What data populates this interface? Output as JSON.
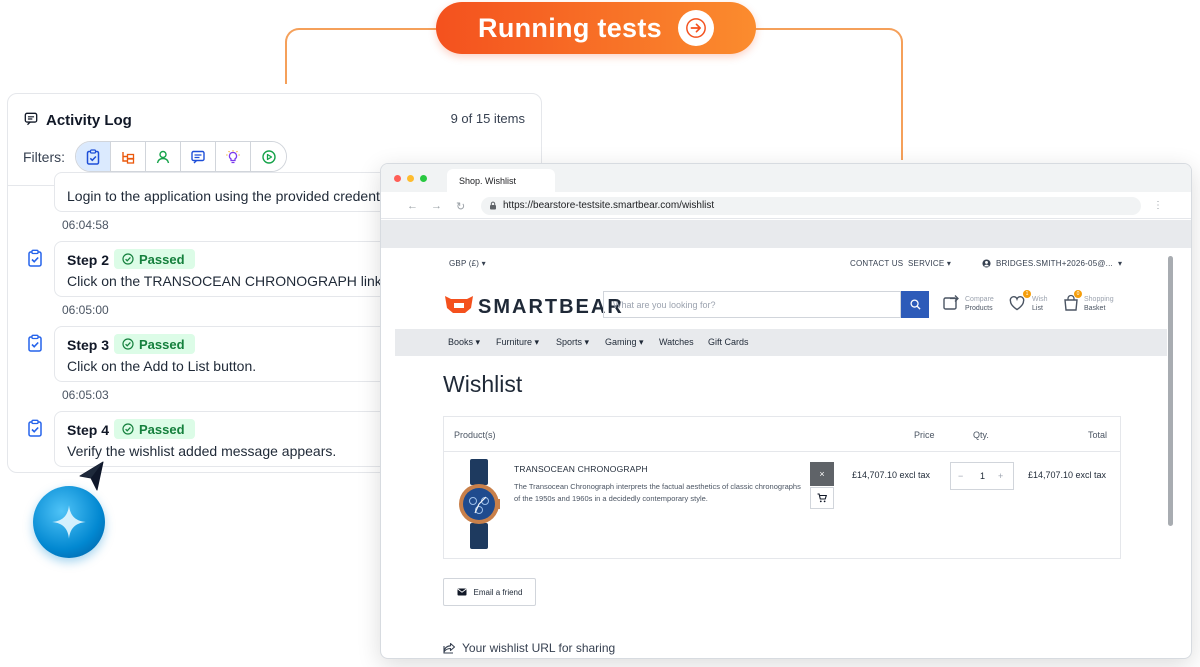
{
  "banner": {
    "label": "Running tests"
  },
  "activity_log": {
    "title": "Activity Log",
    "count": "9 of 15 items",
    "filters_label": "Filters:",
    "filters": [
      "steps-icon",
      "tree-icon",
      "user-icon",
      "comment-icon",
      "lightbulb-icon",
      "play-icon"
    ],
    "entries": [
      {
        "description": "Login to the application using the provided credentials.",
        "time": "06:04:58"
      },
      {
        "step": "Step 2",
        "status": "Passed",
        "description": "Click on the TRANSOCEAN CHRONOGRAPH link.",
        "time": "06:05:00"
      },
      {
        "step": "Step 3",
        "status": "Passed",
        "description": "Click on the Add to List button.",
        "time": "06:05:03"
      },
      {
        "step": "Step 4",
        "status": "Passed",
        "description": "Verify the wishlist added message appears."
      }
    ]
  },
  "browser": {
    "tab_title": "Shop. Wishlist",
    "url": "https://bearstore-testsite.smartbear.com/wishlist"
  },
  "site": {
    "currency": "GBP (£)",
    "contact": "CONTACT US",
    "service": "SERVICE",
    "user": "BRIDGES.SMITH+2026-05@...",
    "logo": "SMARTBEAR",
    "search_placeholder": "What are you looking for?",
    "compare": {
      "l1": "Compare",
      "l2": "Products"
    },
    "wish": {
      "l1": "Wish",
      "l2": "List",
      "badge": "1"
    },
    "basket": {
      "l1": "Shopping",
      "l2": "Basket",
      "badge": "0"
    },
    "categories": [
      "Books",
      "Furniture",
      "Sports",
      "Gaming",
      "Watches",
      "Gift Cards"
    ],
    "page_title": "Wishlist",
    "table": {
      "headers": {
        "product": "Product(s)",
        "price": "Price",
        "qty": "Qty.",
        "total": "Total"
      },
      "row": {
        "name": "TRANSOCEAN CHRONOGRAPH",
        "description": "The Transocean Chronograph interprets the factual aesthetics of classic chronographs of the 1950s and 1960s in a decidedly contemporary style.",
        "remove": "×",
        "price": "£14,707.10 excl tax",
        "minus": "−",
        "qty": "1",
        "plus": "+",
        "total": "£14,707.10 excl tax"
      }
    },
    "email_button": "Email a friend",
    "share_label": "Your wishlist URL for sharing"
  },
  "colors": {
    "accent_orange": "#f4511e",
    "passed_green": "#15803d",
    "brand_blue": "#2d5bb9"
  }
}
